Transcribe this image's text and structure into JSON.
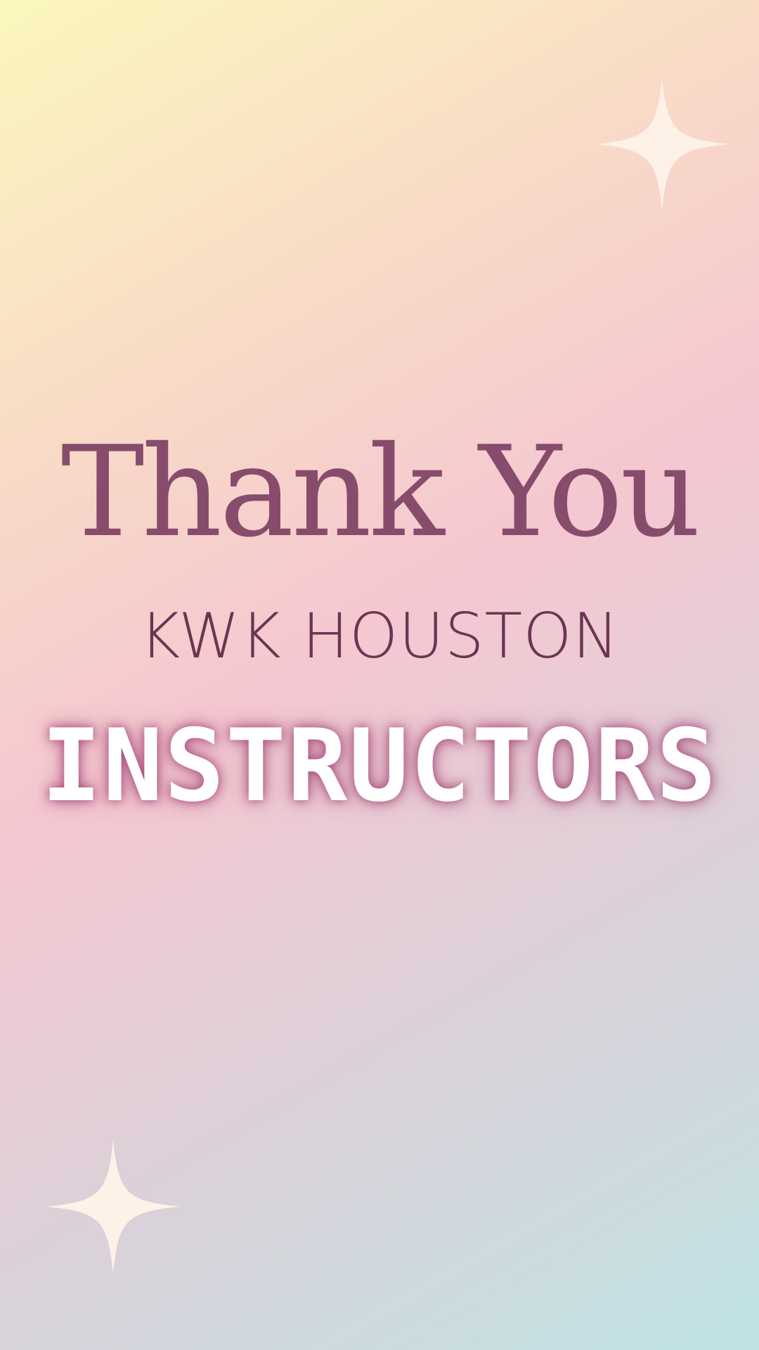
{
  "card": {
    "headline": "Thank You",
    "subtitle": "KWK HOUSTON",
    "banner": "INSTRUCTORS"
  },
  "decorations": {
    "icons": [
      "sparkle-icon",
      "sparkle-icon"
    ]
  },
  "colors": {
    "gradient_start": "#fbf7bd",
    "gradient_mid_peach": "#f8dcc6",
    "gradient_mid_pink": "#f5c7d1",
    "gradient_mid_grey": "#dbd1d9",
    "gradient_end": "#bfe3e4",
    "headline": "#874c6b",
    "subtitle": "#6b3552",
    "banner_text": "#ffffff",
    "banner_glow": "#9e3a6e",
    "sparkle": "#fdf1e8"
  }
}
